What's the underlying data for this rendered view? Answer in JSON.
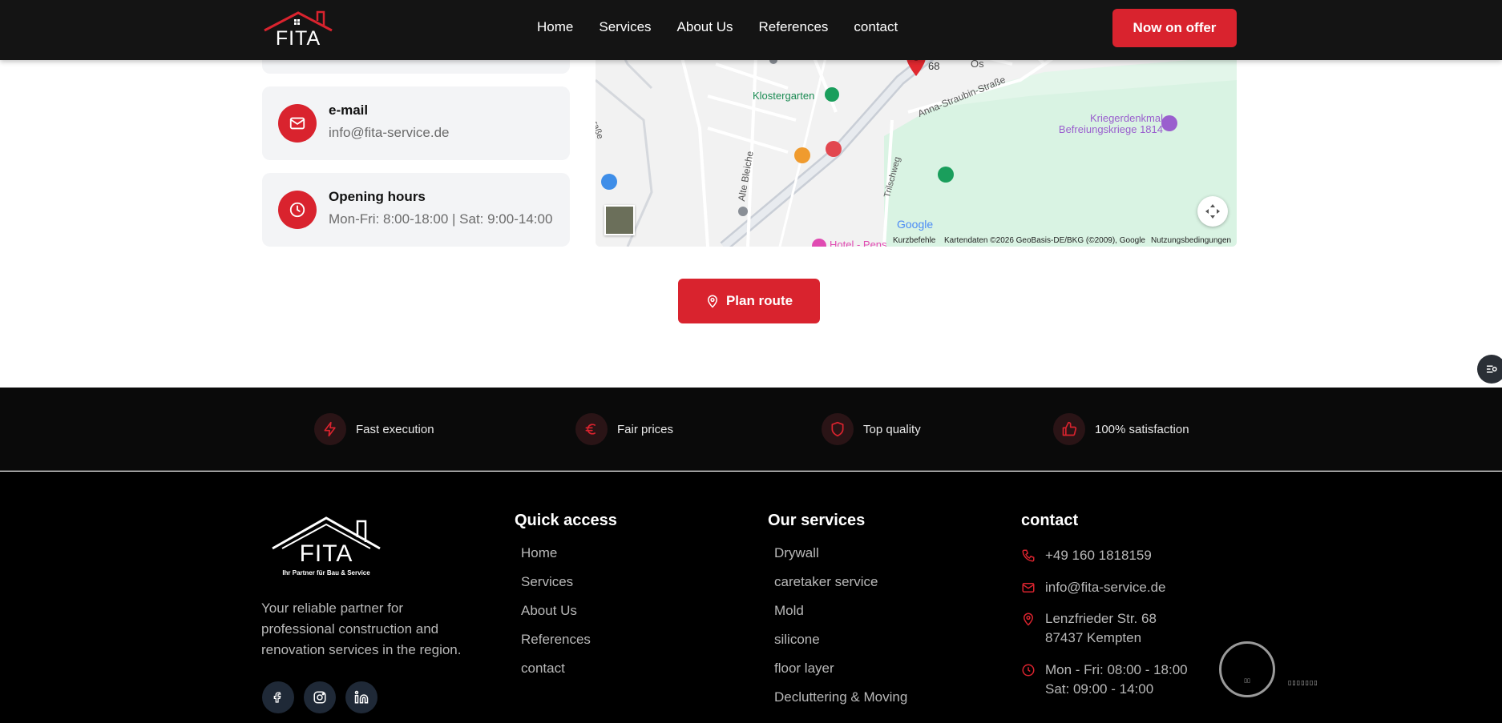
{
  "header": {
    "logo_text": "FITA",
    "nav": [
      "Home",
      "Services",
      "About Us",
      "References",
      "contact"
    ],
    "cta_label": "Now on offer"
  },
  "contact_cards": {
    "email": {
      "title": "e-mail",
      "value": "info@fita-service.de"
    },
    "hours": {
      "title": "Opening hours",
      "value": "Mon-Fri: 8:00-18:00 | Sat: 9:00-14:00"
    }
  },
  "map": {
    "labels": {
      "marker_number": "68",
      "marker_partial": "Os",
      "klostergarten": "Klostergarten",
      "street_anna": "Anna-Straubin-Straße",
      "monument_line1": "Kriegerdenkmal",
      "monument_line2": "Befreiungskriege 1814",
      "alte_bleiche": "Alte Bleiche",
      "trilschweg": "Trilschweg",
      "strasse_partial": "raße",
      "hotel_partial": "Hotel - Pens",
      "google": "Google"
    },
    "attribution": {
      "shortcuts": "Kurzbefehle",
      "map_data": "Kartendaten ©2026 GeoBasis-DE/BKG (©2009), Google",
      "terms": "Nutzungsbedingungen"
    }
  },
  "route_button": "Plan route",
  "features": [
    {
      "label": "Fast execution",
      "icon": "lightning-icon"
    },
    {
      "label": "Fair prices",
      "icon": "euro-icon"
    },
    {
      "label": "Top quality",
      "icon": "shield-icon"
    },
    {
      "label": "100% satisfaction",
      "icon": "thumbs-up-icon"
    }
  ],
  "footer": {
    "logo_text": "FITA",
    "logo_subtitle": "Ihr Partner für Bau & Service",
    "tagline": "Your reliable partner for professional construction and renovation services in the region.",
    "quick_access": {
      "title": "Quick access",
      "items": [
        "Home",
        "Services",
        "About Us",
        "References",
        "contact"
      ]
    },
    "services": {
      "title": "Our services",
      "items": [
        "Drywall",
        "caretaker service",
        "Mold",
        "silicone",
        "floor layer",
        "Decluttering & Moving"
      ]
    },
    "contact": {
      "title": "contact",
      "phone": "+49 160 1818159",
      "email": "info@fita-service.de",
      "address_line1": "Lenzfrieder Str. 68",
      "address_line2": "87437 Kempten",
      "hours_line1": "Mon - Fri: 08:00 - 18:00",
      "hours_line2": "Sat: 09:00 - 14:00"
    },
    "badge_text": "▯▯",
    "badge_boxes": "▯▯▯▯▯▯▯"
  },
  "colors": {
    "accent": "#d9232e",
    "header_bg": "#141414",
    "footer_bg": "#000000",
    "card_bg": "#f3f4f6"
  }
}
